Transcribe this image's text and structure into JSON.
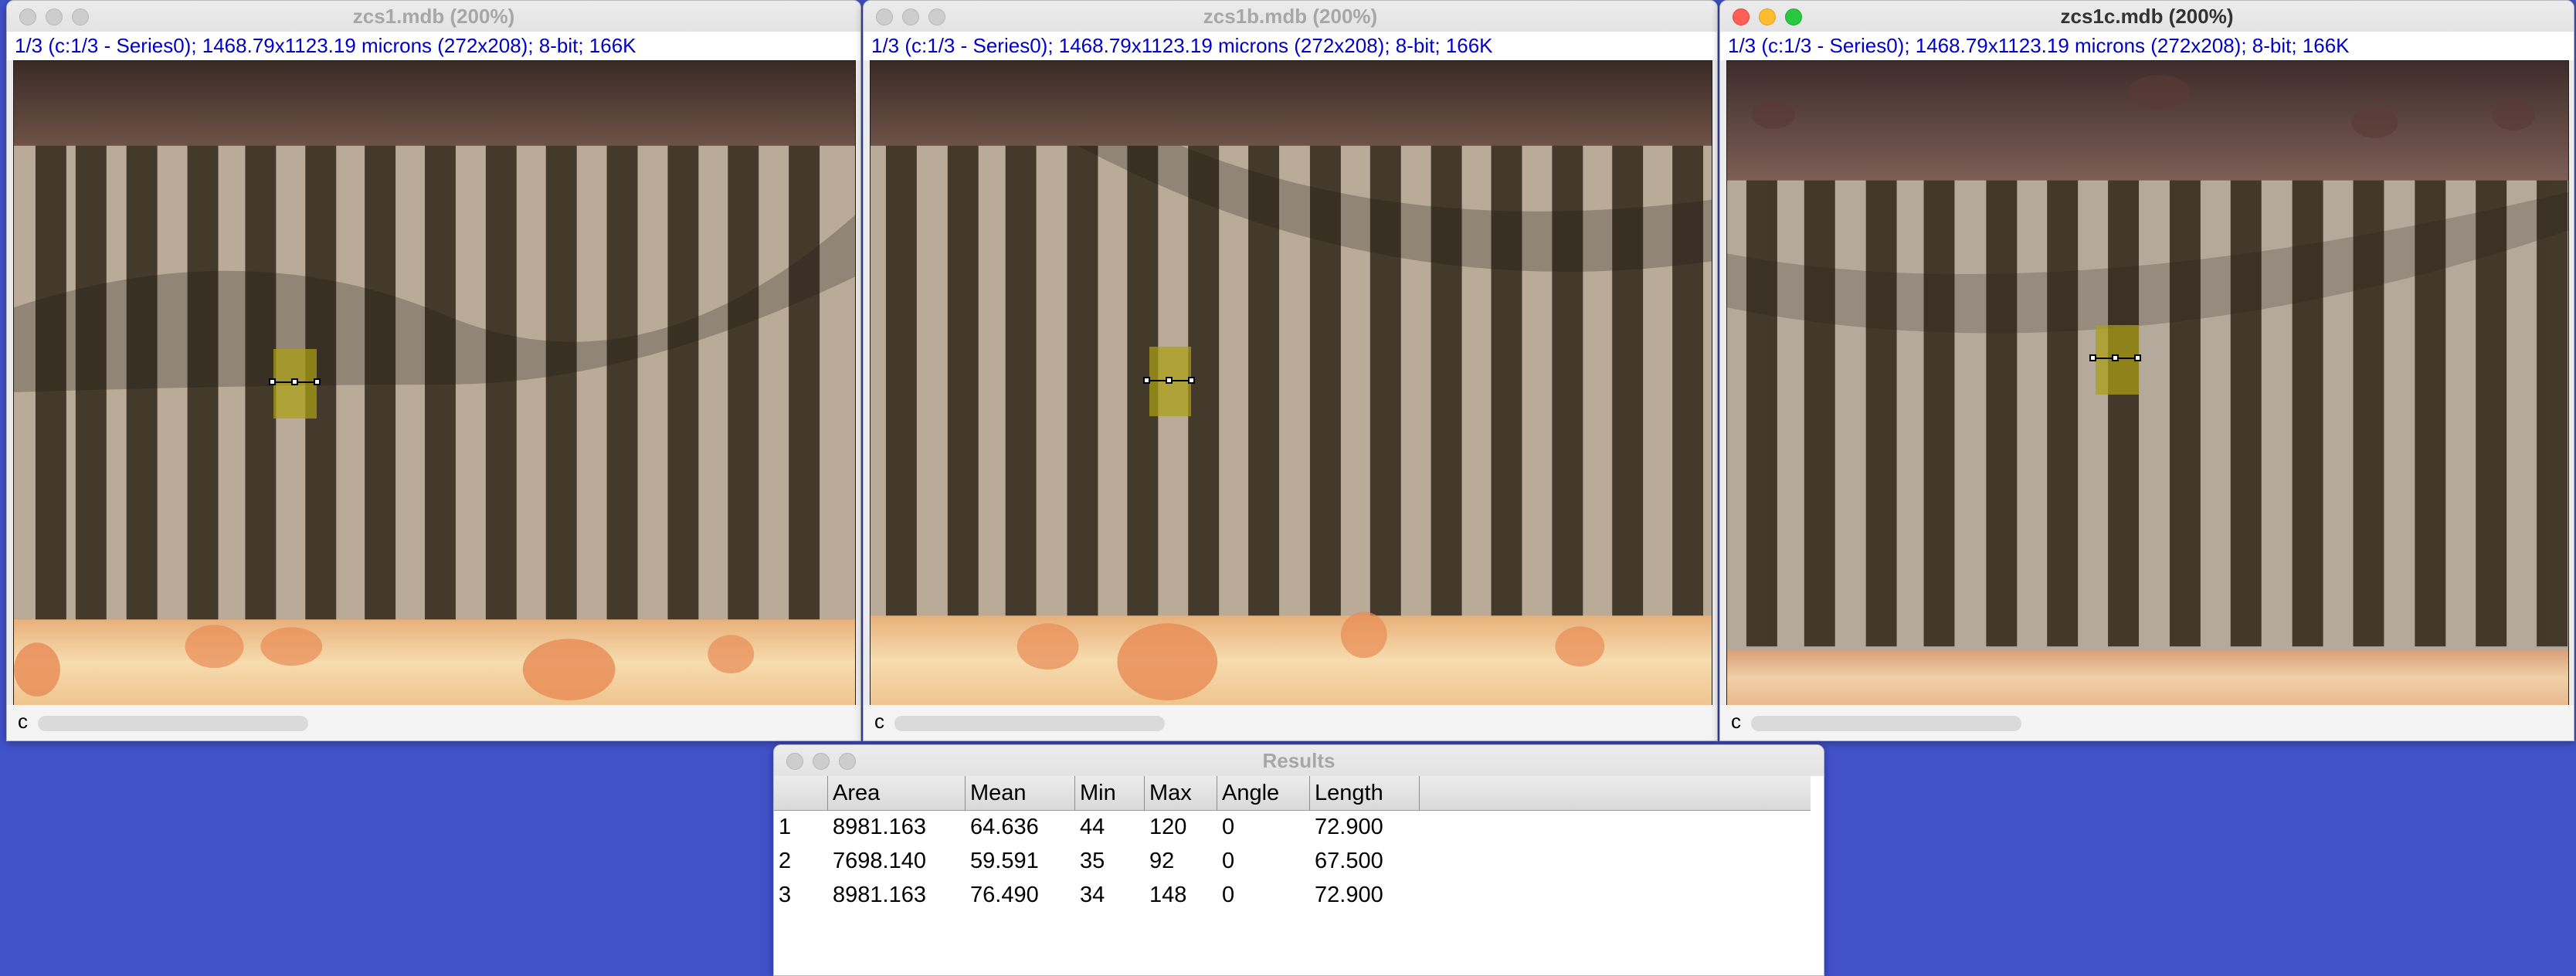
{
  "windows": [
    {
      "title": "zcs1.mdb (200%)",
      "info": "1/3 (c:1/3 - Series0); 1468.79x1123.19 microns (272x208); 8-bit; 166K",
      "channel": "c",
      "active": false
    },
    {
      "title": "zcs1b.mdb (200%)",
      "info": "1/3 (c:1/3 - Series0); 1468.79x1123.19 microns (272x208); 8-bit; 166K",
      "channel": "c",
      "active": false
    },
    {
      "title": "zcs1c.mdb (200%)",
      "info": "1/3 (c:1/3 - Series0); 1468.79x1123.19 microns (272x208); 8-bit; 166K",
      "channel": "c",
      "active": true
    }
  ],
  "results": {
    "title": "Results",
    "columns": [
      "",
      "Area",
      "Mean",
      "Min",
      "Max",
      "Angle",
      "Length"
    ],
    "rows": [
      [
        "1",
        "8981.163",
        "64.636",
        "44",
        "120",
        "0",
        "72.900"
      ],
      [
        "2",
        "7698.140",
        "59.591",
        "35",
        "92",
        "0",
        "67.500"
      ],
      [
        "3",
        "8981.163",
        "76.490",
        "34",
        "148",
        "0",
        "72.900"
      ]
    ]
  },
  "colors": {
    "desktop": "#4151c8",
    "info_text": "#0000c8",
    "roi_fill": "#aaa014",
    "stripe_dark": "#3d3426",
    "stripe_light": "#b9ab97"
  }
}
